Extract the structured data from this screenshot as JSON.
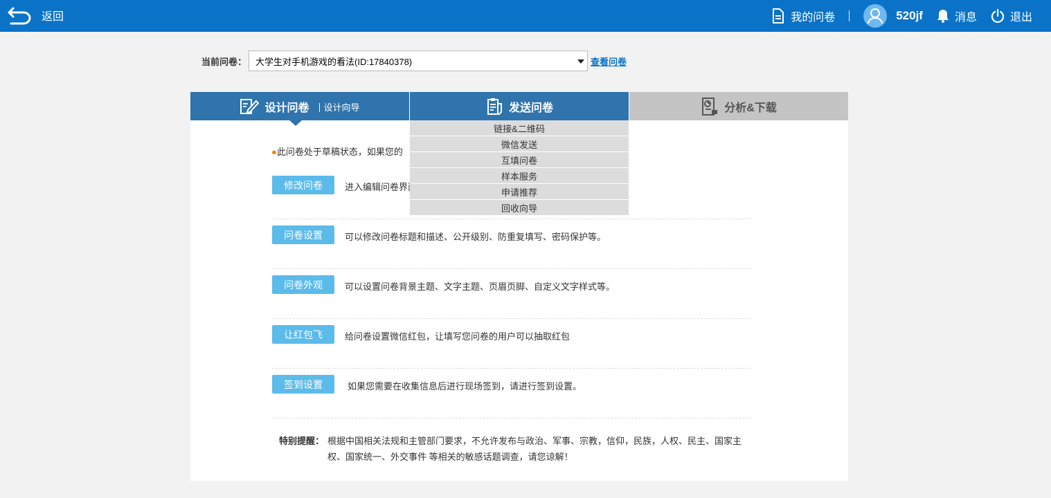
{
  "topbar": {
    "back_label": "返回",
    "my_surveys": "我的问卷",
    "username": "520jf",
    "messages": "消息",
    "logout": "退出"
  },
  "survey_select": {
    "label": "当前问卷：",
    "selected": "大学生对手机游戏的看法(ID:17840378)",
    "view_link": "查看问卷"
  },
  "tabs": {
    "design": {
      "label": "设计问卷",
      "sub": "设计向导"
    },
    "send": {
      "label": "发送问卷"
    },
    "analyze": {
      "label": "分析&下载"
    }
  },
  "send_menu": [
    "链接&二维码",
    "微信发送",
    "互填问卷",
    "样本服务",
    "申请推荐",
    "回收向导"
  ],
  "notice": "此问卷处于草稿状态，如果您的",
  "actions": [
    {
      "button": "修改问卷",
      "desc": "进入编辑问卷界面"
    },
    {
      "button": "问卷设置",
      "desc": "可以修改问卷标题和描述、公开级别、防重复填写、密码保护等。"
    },
    {
      "button": "问卷外观",
      "desc": "可以设置问卷背景主题、文字主题、页眉页脚、自定义文字样式等。"
    },
    {
      "button": "让红包飞",
      "desc": "给问卷设置微信红包，让填写您问卷的用户可以抽取红包"
    },
    {
      "button": "签到设置",
      "desc": "如果您需要在收集信息后进行现场签到，请进行签到设置。"
    }
  ],
  "reminder": {
    "label": "特别提醒：",
    "text": "根据中国相关法规和主管部门要求，不允许发布与政治、军事、宗教，信仰，民族，人权、民主、国家主权、国家统一、外交事件 等相关的敏感话题调查，请您谅解！"
  },
  "colors": {
    "topbar": "#0a73c8",
    "tab_active": "#2f74ad",
    "tab_inactive": "#c4c4c4",
    "button": "#5bbbea",
    "accent_dot": "#f08300"
  }
}
